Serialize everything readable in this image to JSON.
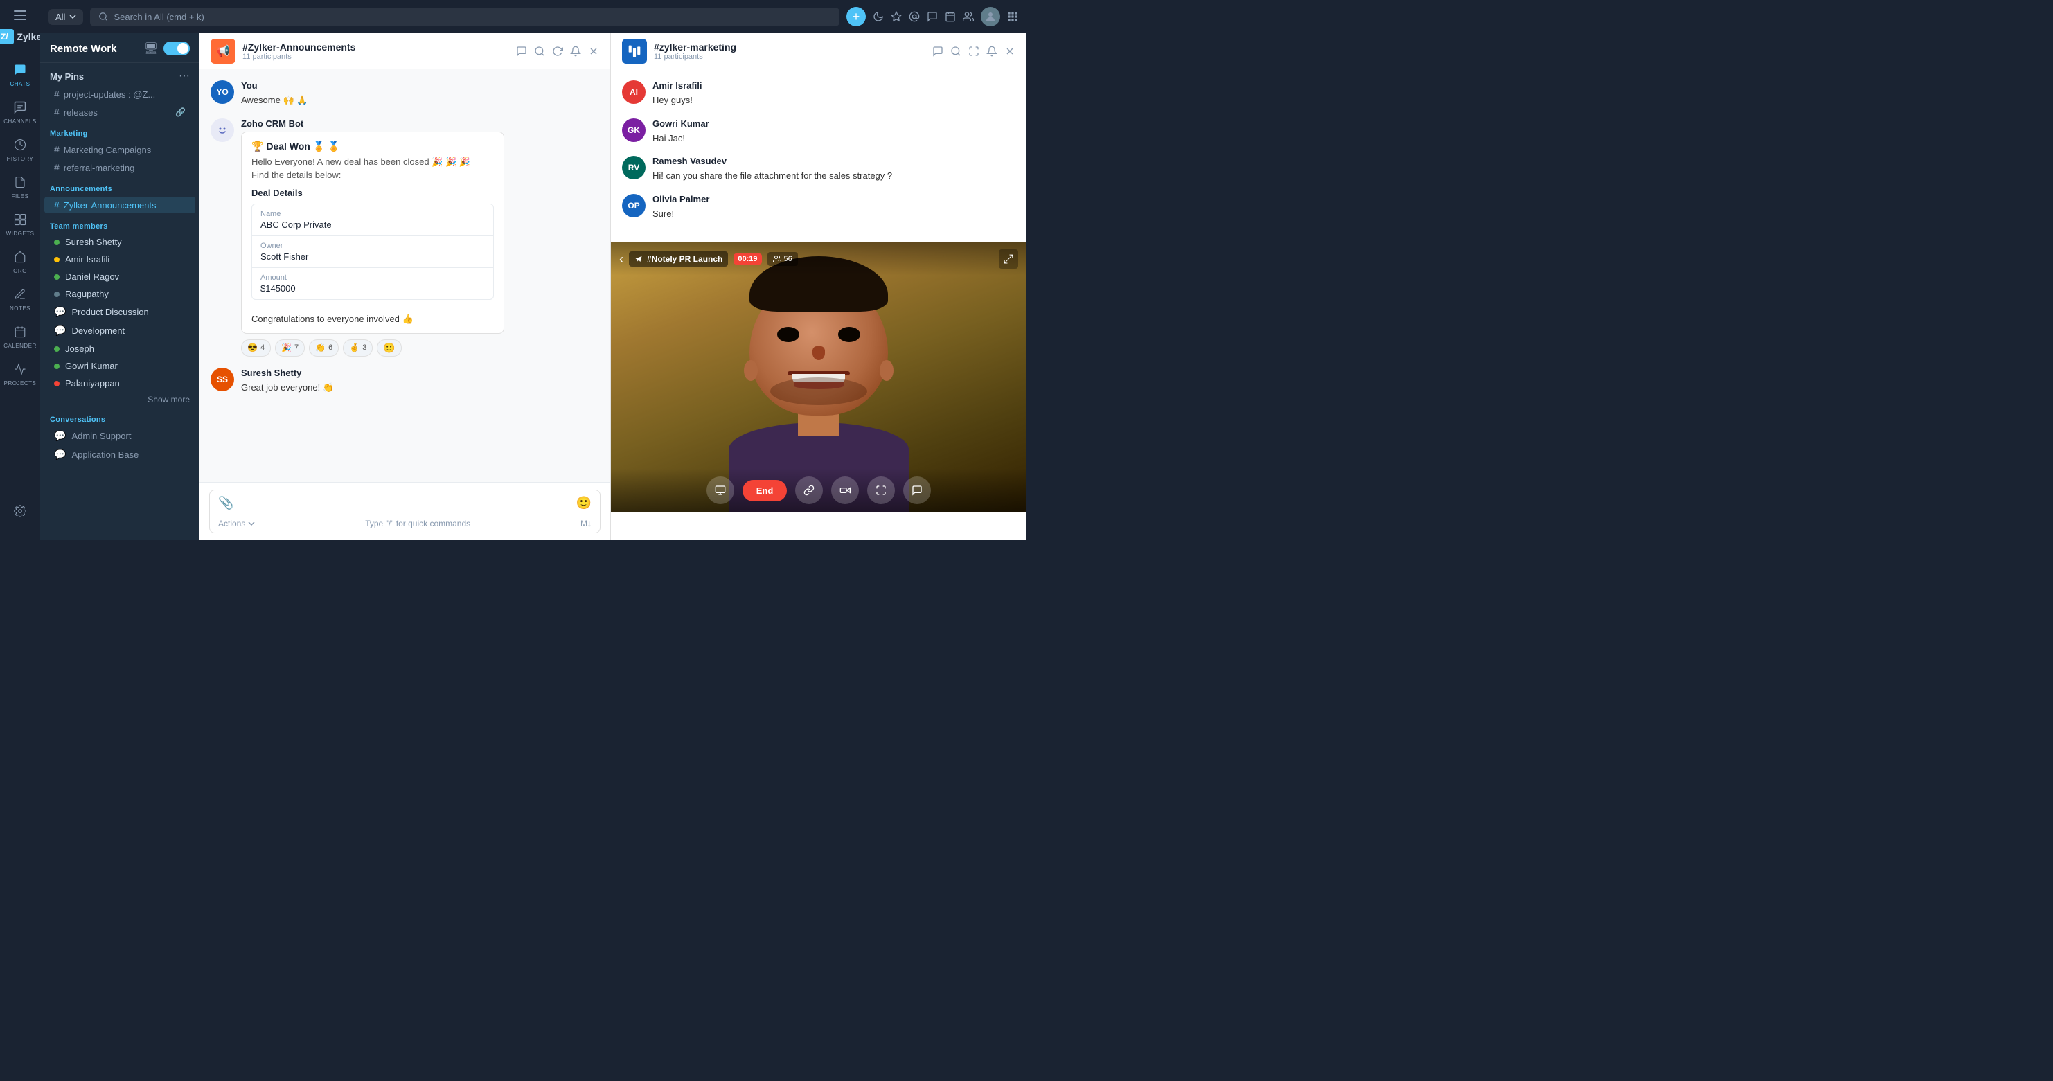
{
  "app": {
    "name": "Zylker"
  },
  "topbar": {
    "search_placeholder": "Search in All (cmd + k)",
    "filter": "All",
    "add_btn": "+",
    "icons": [
      "moon",
      "star",
      "at",
      "hashtag",
      "calendar",
      "grid",
      "user-avatar",
      "apps"
    ]
  },
  "sidebar": {
    "workspace": "Remote Work",
    "nav_items": [
      {
        "icon": "💬",
        "label": "CHATS",
        "active": true
      },
      {
        "icon": "#",
        "label": "CHANNELS",
        "active": false
      },
      {
        "icon": "🕐",
        "label": "HISTORY",
        "active": false
      },
      {
        "icon": "📄",
        "label": "FILES",
        "active": false
      },
      {
        "icon": "⊞",
        "label": "WIDGETS",
        "active": false
      },
      {
        "icon": "🏢",
        "label": "ORG",
        "active": false
      },
      {
        "icon": "📝",
        "label": "NOTES",
        "active": false
      },
      {
        "icon": "📅",
        "label": "CALENDER",
        "active": false
      },
      {
        "icon": "📋",
        "label": "PROJECTS",
        "active": false
      }
    ],
    "pins_title": "My Pins",
    "pinned_channels": [
      {
        "name": "project-updates : @Z...",
        "active": false
      },
      {
        "name": "releases",
        "active": false,
        "icon": "🔗"
      }
    ],
    "marketing_section": "Marketing",
    "marketing_channels": [
      {
        "name": "Marketing Campaigns"
      },
      {
        "name": "referral-marketing"
      }
    ],
    "announcements_section": "Announcements",
    "announcement_channels": [
      {
        "name": "Zylker-Announcements",
        "active": true
      }
    ],
    "team_section": "Team members",
    "team_members": [
      {
        "name": "Suresh Shetty",
        "status": "green"
      },
      {
        "name": "Amir Israfili",
        "status": "yellow"
      },
      {
        "name": "Daniel Ragov",
        "status": "green"
      },
      {
        "name": "Ragupathy",
        "status": "grey"
      },
      {
        "name": "Product Discussion",
        "status": "chat",
        "icon": "💬"
      },
      {
        "name": "Development",
        "status": "chat",
        "icon": "💬"
      },
      {
        "name": "Joseph",
        "status": "green"
      },
      {
        "name": "Gowri Kumar",
        "status": "green"
      },
      {
        "name": "Palaniyappan",
        "status": "red"
      }
    ],
    "show_more": "Show more",
    "conversations_section": "Conversations",
    "conversations": [
      {
        "name": "Admin Support",
        "icon": "💬"
      },
      {
        "name": "Application Base",
        "icon": "💬"
      }
    ]
  },
  "announcement_channel": {
    "name": "#Zylker-Announcements",
    "participants": "11 participants",
    "messages": [
      {
        "sender": "You",
        "avatar_text": "YO",
        "avatar_color": "blue",
        "text": "Awesome 🙌 🙏"
      },
      {
        "sender": "Zoho CRM Bot",
        "is_bot": true,
        "card": {
          "title": "🏆 Deal Won 🏅 🏅",
          "intro": "Hello Everyone! A new deal has been closed 🎉 🎉 🎉\nFind the details below:",
          "deal_details_label": "Deal Details",
          "fields": [
            {
              "label": "Name",
              "value": "ABC Corp Private"
            },
            {
              "label": "Owner",
              "value": "Scott Fisher"
            },
            {
              "label": "Amount",
              "value": "$145000"
            }
          ],
          "footer": "Congratulations to everyone involved 👍"
        },
        "reactions": [
          {
            "emoji": "😎",
            "count": "4"
          },
          {
            "emoji": "🎉",
            "count": "7"
          },
          {
            "emoji": "👏",
            "count": "6"
          },
          {
            "emoji": "🤞",
            "count": "3"
          }
        ]
      },
      {
        "sender": "Suresh Shetty",
        "avatar_text": "SS",
        "avatar_color": "orange",
        "text": "Great job everyone! 👏"
      }
    ],
    "input_placeholder": "",
    "quick_commands": "Type \"/\" for quick commands",
    "markdown_hint": "M↓",
    "actions_label": "Actions"
  },
  "marketing_channel": {
    "name": "#zylker-marketing",
    "participants": "11 participants",
    "messages": [
      {
        "sender": "Amir Israfili",
        "avatar_text": "AI",
        "text": "Hey guys!"
      },
      {
        "sender": "Gowri Kumar",
        "avatar_text": "GK",
        "text": "Hai Jac!"
      },
      {
        "sender": "Ramesh Vasudev",
        "avatar_text": "RV",
        "text": "Hi! can you share the file attachment for the sales strategy ?"
      },
      {
        "sender": "Olivia Palmer",
        "avatar_text": "OP",
        "text": "Sure!"
      }
    ]
  },
  "video_call": {
    "channel": "#Notely PR Launch",
    "timer": "00:19",
    "participants": "56"
  }
}
